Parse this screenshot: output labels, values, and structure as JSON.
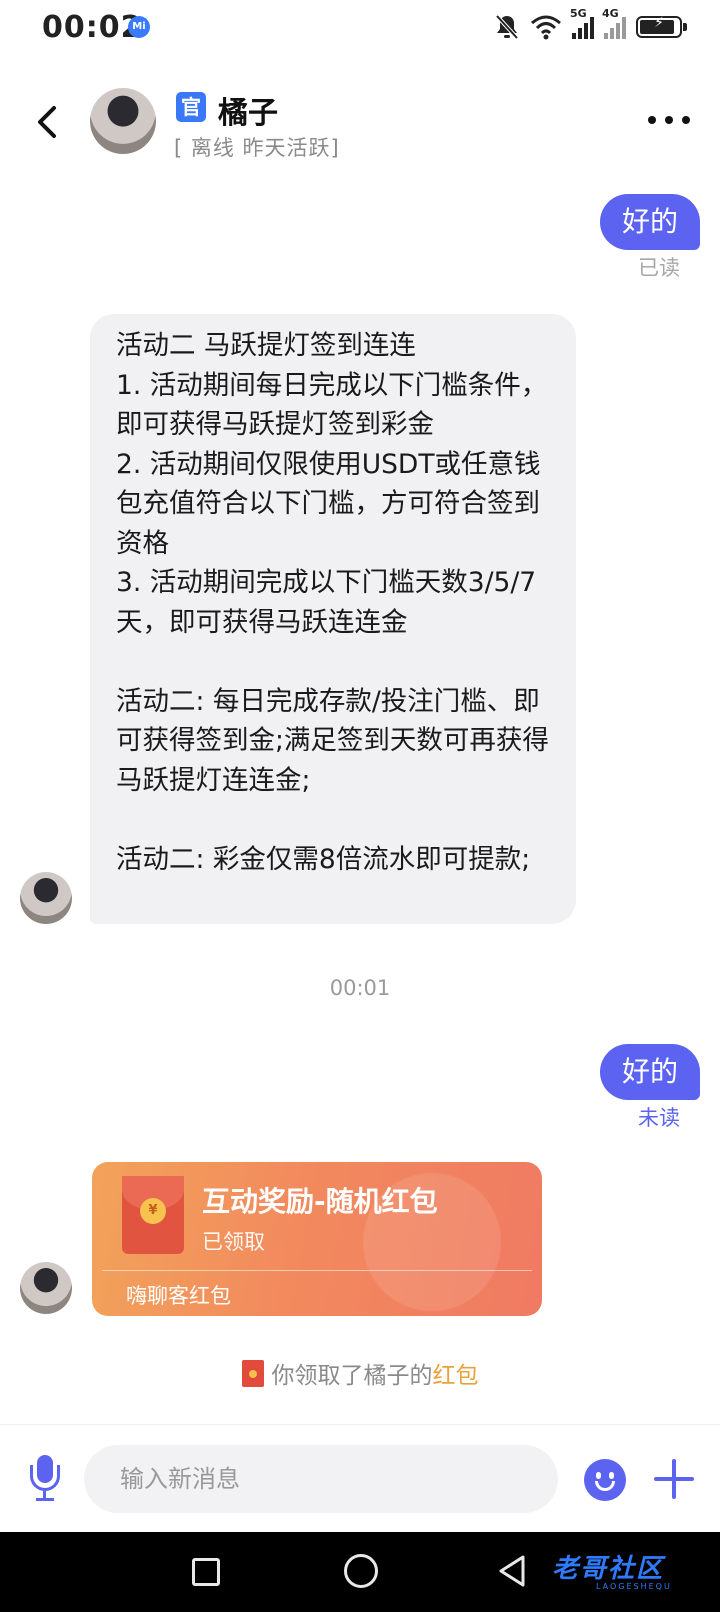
{
  "status_bar": {
    "time": "00:02",
    "mi_badge": "Mi",
    "signal_labels": [
      "5G",
      "4G"
    ],
    "battery_level": 0.9
  },
  "header": {
    "official_badge": "官",
    "contact_name": "橘子",
    "contact_status": "[ 离线 昨天活跃]"
  },
  "messages": {
    "out_1": {
      "text": "好的",
      "status": "已读"
    },
    "in_1": {
      "text": "活动二 马跃提灯签到连连\n1. 活动期间每日完成以下门槛条件，即可获得马跃提灯签到彩金\n2. 活动期间仅限使用USDT或任意钱包充值符合以下门槛，方可符合签到资格\n3. 活动期间完成以下门槛天数3/5/7天，即可获得马跃连连金\n\n活动二: 每日完成存款/投注门槛、即可获得签到金;满足签到天数可再获得马跃提灯连连金;\n\n活动二: 彩金仅需8倍流水即可提款;"
    },
    "time_divider": "00:01",
    "out_2": {
      "text": "好的",
      "status": "未读"
    },
    "red_packet": {
      "coin_symbol": "¥",
      "title": "互动奖励-随机红包",
      "status": "已领取",
      "footer": "嗨聊客红包"
    },
    "notice": {
      "prefix": "你领取了橘子的",
      "highlight": "红包"
    }
  },
  "input_bar": {
    "placeholder": "输入新消息",
    "value": ""
  },
  "watermark": {
    "text": "老哥社区",
    "sub": "LAOGESHEQU"
  },
  "colors": {
    "accent": "#5b63f0",
    "bubble_in": "#f1f1f3",
    "unread": "#5b63f0",
    "read": "#a7a7a7",
    "red_packet": "#f28a5e",
    "highlight": "#e9a23b"
  }
}
